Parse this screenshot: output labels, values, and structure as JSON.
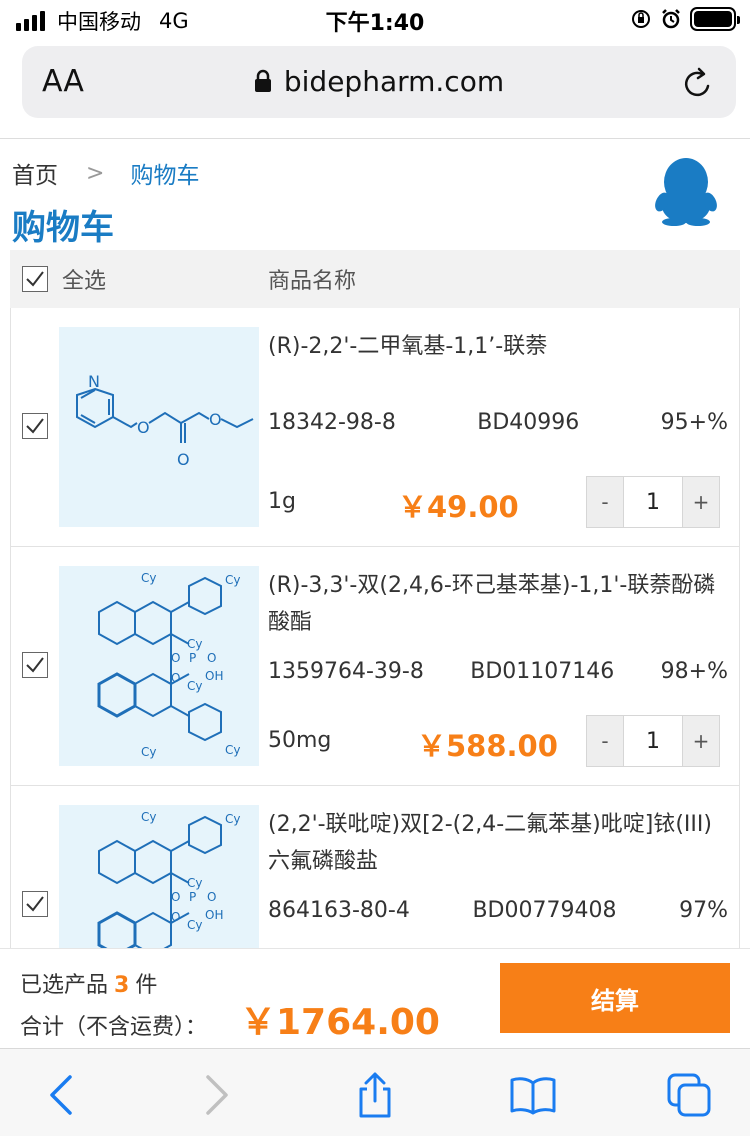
{
  "status_bar": {
    "carrier": "中国移动",
    "network": "4G",
    "time": "下午1:40",
    "battery_level": 1.0
  },
  "browser": {
    "text_size_label": "AA",
    "url": "bidepharm.com",
    "icons": [
      "lock-icon",
      "reload-icon",
      "back-icon",
      "forward-icon",
      "share-icon",
      "bookmarks-icon",
      "tabs-icon"
    ]
  },
  "breadcrumb": {
    "home": "首页",
    "separator": ">",
    "current": "购物车"
  },
  "page_title": "购物车",
  "table_header": {
    "select_all": "全选",
    "product_name": "商品名称",
    "select_all_checked": true
  },
  "items": [
    {
      "checked": true,
      "name": "(R)-2,2'-二甲氧基-1,1’-联萘",
      "cas": "18342-98-8",
      "code": "BD40996",
      "purity": "95+%",
      "spec": "1g",
      "price": "￥49.00",
      "quantity": "1",
      "structure_labels": [
        "N",
        "O",
        "O",
        "O"
      ]
    },
    {
      "checked": true,
      "name": "(R)-3,3'-双(2,4,6-环己基苯基)-1,1'-联萘酚磷酸酯",
      "cas": "1359764-39-8",
      "code": "BD01107146",
      "purity": "98+%",
      "spec": "50mg",
      "price": "￥588.00",
      "quantity": "1",
      "structure_labels": [
        "Cy",
        "Cy",
        "Cy",
        "Cy",
        "Cy",
        "Cy",
        "O",
        "O",
        "P",
        "O",
        "OH"
      ]
    },
    {
      "checked": true,
      "name": "(2,2'-联吡啶)双[2-(2,4-二氟苯基)吡啶]铱(III) 六氟磷酸盐",
      "cas": "864163-80-4",
      "code": "BD00779408",
      "purity": "97%",
      "structure_labels": [
        "Cy",
        "Cy",
        "Cy",
        "Cy",
        "O",
        "O",
        "P",
        "O",
        "OH"
      ]
    }
  ],
  "stepper": {
    "minus": "-",
    "plus": "+"
  },
  "summary": {
    "selected_prefix": "已选产品",
    "selected_count": "3",
    "selected_suffix": "件",
    "total_label": "合计（不含运费）：",
    "total": "￥1764.00",
    "checkout": "结算"
  },
  "colors": {
    "brand_blue": "#1a7cc4",
    "accent_orange": "#f77f17",
    "thumb_bg": "#e6f4fb"
  }
}
